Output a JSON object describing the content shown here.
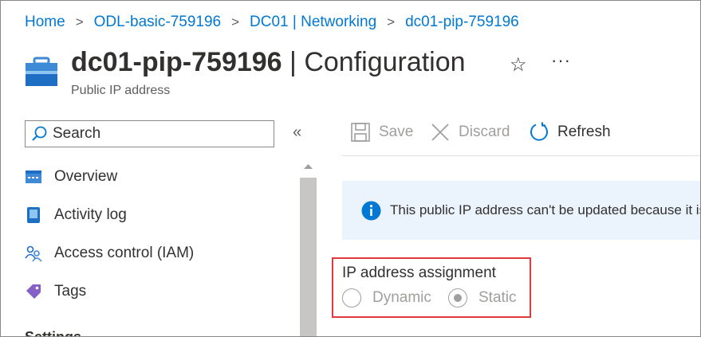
{
  "breadcrumb": {
    "items": [
      "Home",
      "ODL-basic-759196",
      "DC01 | Networking",
      "dc01-pip-759196"
    ],
    "separator": ">"
  },
  "header": {
    "resource_name": "dc01-pip-759196",
    "blade_name": " | Configuration",
    "subtitle": "Public IP address",
    "favorite_icon": "star-icon",
    "more_label": "···"
  },
  "sidebar": {
    "search_placeholder": "Search",
    "collapse_label": "«",
    "items": [
      {
        "label": "Overview",
        "icon": "overview-icon"
      },
      {
        "label": "Activity log",
        "icon": "activity-log-icon"
      },
      {
        "label": "Access control (IAM)",
        "icon": "iam-icon"
      },
      {
        "label": "Tags",
        "icon": "tag-icon"
      }
    ],
    "section_heading": "Settings"
  },
  "toolbar": {
    "save_label": "Save",
    "discard_label": "Discard",
    "refresh_label": "Refresh"
  },
  "info_bar": {
    "message": "This public IP address can't be updated because it is associated with a resource"
  },
  "assignment": {
    "label": "IP address assignment",
    "options": [
      "Dynamic",
      "Static"
    ],
    "selected": "Static",
    "disabled": true
  },
  "colors": {
    "accent": "#0078d4",
    "highlight_border": "#e03a3e",
    "info_background": "#ebf3fc",
    "disabled_text": "#a19f9d"
  }
}
